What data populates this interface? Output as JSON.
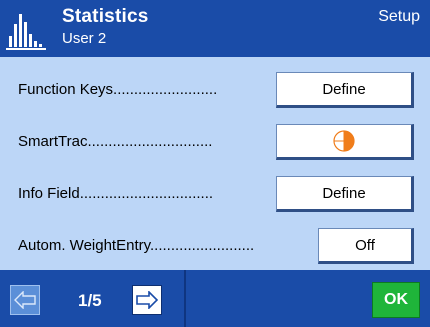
{
  "header": {
    "title": "Statistics",
    "user": "User 2",
    "mode": "Setup",
    "icon": "bar-chart-icon"
  },
  "rows": [
    {
      "label": "Function Keys.........................",
      "button_label": "Define"
    },
    {
      "label": "SmartTrac..............................",
      "button_icon": "smarttrac-icon"
    },
    {
      "label": "Info Field................................",
      "button_label": "Define"
    },
    {
      "label": "Autom. WeightEntry.........................",
      "button_label": "Off"
    }
  ],
  "footer": {
    "page_indicator": "1/5",
    "ok_label": "OK",
    "prev_icon": "arrow-left-icon",
    "next_icon": "arrow-right-icon"
  },
  "colors": {
    "header_bg": "#1a4ca8",
    "content_bg": "#bcd6f7",
    "ok_green": "#1fb53a",
    "smarttrac_orange": "#f07d1a"
  }
}
